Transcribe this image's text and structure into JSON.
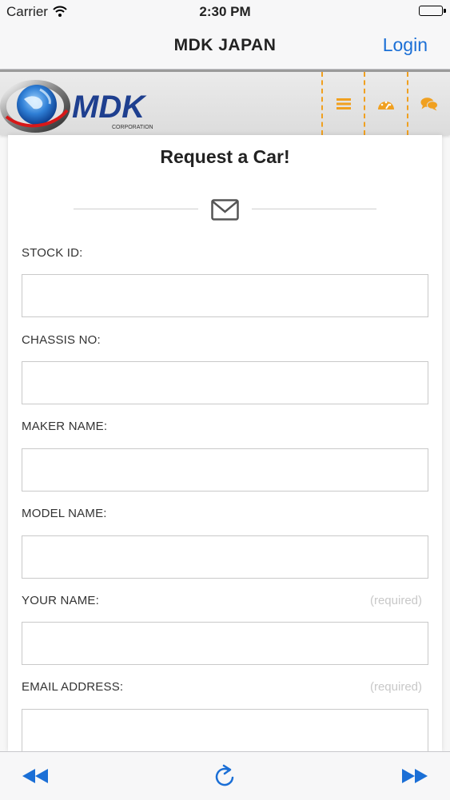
{
  "status_bar": {
    "carrier": "Carrier",
    "time": "2:30 PM"
  },
  "nav_bar": {
    "title": "MDK JAPAN",
    "login_label": "Login"
  },
  "logo": {
    "brand": "MDK",
    "subtitle": "CORPORATION"
  },
  "header_icons": [
    "menu-icon",
    "dashboard-icon",
    "chat-icon"
  ],
  "form": {
    "heading": "Request a Car!",
    "fields": [
      {
        "label": "STOCK ID:",
        "required_note": "",
        "value": ""
      },
      {
        "label": "CHASSIS NO:",
        "required_note": "",
        "value": ""
      },
      {
        "label": "MAKER NAME:",
        "required_note": "",
        "value": ""
      },
      {
        "label": "MODEL NAME:",
        "required_note": "",
        "value": ""
      },
      {
        "label": "YOUR NAME:",
        "required_note": "(required)",
        "value": ""
      },
      {
        "label": "EMAIL ADDRESS:",
        "required_note": "(required)",
        "value": ""
      }
    ]
  },
  "toolbar_icons": [
    "rewind-icon",
    "reload-icon",
    "fast-forward-icon"
  ],
  "colors": {
    "accent_orange": "#f0a020",
    "ios_blue": "#1b6fd6",
    "brand_blue": "#1e3f8f"
  }
}
